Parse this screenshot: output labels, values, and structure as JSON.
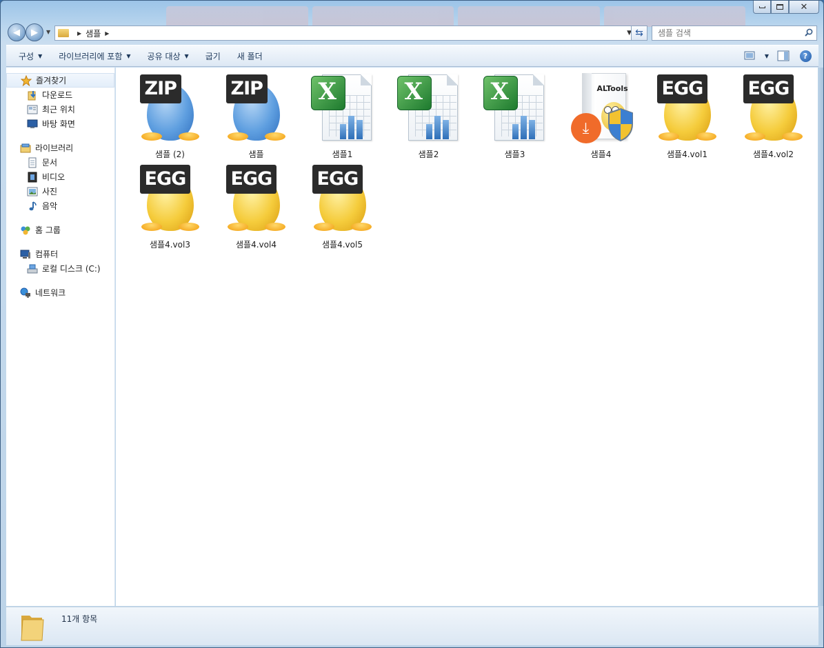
{
  "window": {
    "colors": {
      "accent": "#3a6ea5",
      "toolbar_text": "#1e395b",
      "selection": "#e3eefa"
    }
  },
  "address": {
    "path": [
      "샘플"
    ]
  },
  "search": {
    "placeholder": "샘플 검색"
  },
  "toolbar": {
    "organize": "구성",
    "include_in_library": "라이브러리에 포함",
    "share_with": "공유 대상",
    "burn": "굽기",
    "new_folder": "새 폴더"
  },
  "nav": {
    "favorites": {
      "label": "즐겨찾기",
      "items": [
        "다운로드",
        "최근 위치",
        "바탕 화면"
      ]
    },
    "libraries": {
      "label": "라이브러리",
      "items": [
        "문서",
        "비디오",
        "사진",
        "음악"
      ]
    },
    "homegroup": {
      "label": "홈 그룹"
    },
    "computer": {
      "label": "컴퓨터",
      "items": [
        "로컬 디스크 (C:)"
      ]
    },
    "network": {
      "label": "네트워크"
    }
  },
  "files": [
    {
      "name": "샘플 (2)",
      "type": "zip",
      "badge": "ZIP"
    },
    {
      "name": "샘플",
      "type": "zip",
      "badge": "ZIP"
    },
    {
      "name": "샘플1",
      "type": "excel"
    },
    {
      "name": "샘플2",
      "type": "excel"
    },
    {
      "name": "샘플3",
      "type": "excel"
    },
    {
      "name": "샘플4",
      "type": "installer",
      "box_label": "ALTools"
    },
    {
      "name": "샘플4.vol1",
      "type": "egg",
      "badge": "EGG"
    },
    {
      "name": "샘플4.vol2",
      "type": "egg",
      "badge": "EGG"
    },
    {
      "name": "샘플4.vol3",
      "type": "egg",
      "badge": "EGG"
    },
    {
      "name": "샘플4.vol4",
      "type": "egg",
      "badge": "EGG"
    },
    {
      "name": "샘플4.vol5",
      "type": "egg",
      "badge": "EGG"
    }
  ],
  "details": {
    "count_text": "11개 항목"
  }
}
